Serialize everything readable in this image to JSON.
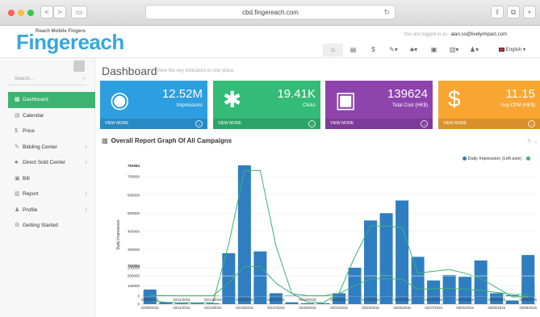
{
  "browser": {
    "url": "cbd.fingereach.com",
    "nav_back": "<",
    "nav_forward": ">",
    "dot_colors": [
      "#fc605c",
      "#fdbc40",
      "#34c84a"
    ]
  },
  "header": {
    "brand_tagline": "Reach Mobile Fingers",
    "brand_name": "Fingereach",
    "logged_in_label": "You are logged in as",
    "user_email": "alan.so@livelyimpact.com",
    "language": "English",
    "icons": [
      "home-icon",
      "calendar-icon",
      "dollar-icon",
      "bidding-icon",
      "sitemap-icon",
      "bill-icon",
      "report-icon",
      "user-icon"
    ]
  },
  "sidebar": {
    "search_placeholder": "Search...",
    "items": [
      {
        "label": "Dashboard",
        "icon": "dashboard-icon",
        "glyph": "▦",
        "active": true,
        "chevron": ""
      },
      {
        "label": "Calendar",
        "icon": "calendar-icon",
        "glyph": "▤",
        "active": false,
        "chevron": ""
      },
      {
        "label": "Price",
        "icon": "dollar-icon",
        "glyph": "$",
        "active": false,
        "chevron": ""
      },
      {
        "label": "Bidding Center",
        "icon": "gavel-icon",
        "glyph": "✎",
        "active": false,
        "chevron": "›"
      },
      {
        "label": "Direct Sold Center",
        "icon": "sitemap-icon",
        "glyph": "♣",
        "active": false,
        "chevron": "›"
      },
      {
        "label": "Bill",
        "icon": "bill-icon",
        "glyph": "▣",
        "active": false,
        "chevron": ""
      },
      {
        "label": "Report",
        "icon": "report-icon",
        "glyph": "▥",
        "active": false,
        "chevron": "›"
      },
      {
        "label": "Profile",
        "icon": "user-icon",
        "glyph": "♟",
        "active": false,
        "chevron": "›"
      },
      {
        "label": "Getting Started",
        "icon": "gears-icon",
        "glyph": "⚙",
        "active": false,
        "chevron": ""
      }
    ]
  },
  "main": {
    "title": "Dashboard",
    "subtitle": "View the key indicators in one place",
    "cards": [
      {
        "value": "12.52M",
        "label": "Impressions",
        "footer": "VIEW MORE",
        "color": "#2d9ee0",
        "icon": "eye-icon",
        "glyph": "◉"
      },
      {
        "value": "19.41K",
        "label": "Clicks",
        "footer": "VIEW MORE",
        "color": "#33bb77",
        "icon": "asterisk-icon",
        "glyph": "✱"
      },
      {
        "value": "139624",
        "label": "Total Cost (HK$)",
        "footer": "VIEW MORE",
        "color": "#8e44ad",
        "icon": "money-icon",
        "glyph": "▣"
      },
      {
        "value": "11.15",
        "label": "Avg CPM (HK$)",
        "footer": "VIEW MORE",
        "color": "#f9a532",
        "icon": "dollar-icon",
        "glyph": "$"
      }
    ],
    "chart_section_title": "Overall Report Graph Of All Campaigns",
    "legend": [
      {
        "name": "Daily Impression (Left axis)",
        "color": "#2f7ec1"
      },
      {
        "name": "",
        "color": "#3cb371"
      }
    ]
  },
  "chart_data": [
    {
      "type": "bar",
      "ylabel": "Daily Impression",
      "ylim": [
        0,
        763084
      ],
      "y_ticks": [
        0,
        100000,
        200000,
        300000,
        400000,
        500000,
        600000,
        700000
      ],
      "y_tick_labels": [
        "0",
        "100000",
        "200000",
        "300000",
        "400000",
        "500000",
        "600000",
        "700000"
      ],
      "ymax_label": "763084",
      "x_tick_labels": [
        "02/09/2015",
        "02/11/2015",
        "02/13/2015",
        "02/15/2015",
        "02/17/2015",
        "02/19/2015",
        "02/21/2015",
        "02/23/2015",
        "02/25/2015",
        "02/27/2015",
        "03/01/2015",
        "03/03/2015",
        "03/05/2015",
        "03/07/2015"
      ],
      "series": [
        {
          "name": "Daily Impression (Left axis)",
          "values": [
            80000,
            10000,
            5000,
            5000,
            5000,
            280000,
            763084,
            290000,
            60000,
            10000,
            5000,
            5000,
            60000,
            200000,
            460000,
            500000,
            570000,
            260000,
            130000,
            160000,
            150000,
            240000,
            60000,
            20000,
            270000
          ]
        },
        {
          "name": "",
          "values": [
            20000,
            10000,
            8000,
            8000,
            8000,
            330000,
            735000,
            735000,
            320000,
            60000,
            10000,
            8000,
            60000,
            260000,
            430000,
            430000,
            420000,
            170000,
            180000,
            190000,
            170000,
            140000,
            90000,
            40000,
            40000
          ]
        }
      ]
    },
    {
      "type": "bar",
      "ylim": [
        0,
        763084
      ],
      "y_tick_labels": [
        "0",
        "500000"
      ],
      "ymax_label": "763084",
      "x_tick_labels": [
        "02/09/2015",
        "02/11/2015",
        "02/13/2015",
        "02/15/2015",
        "02/17/2015",
        "02/19/2015",
        "02/21/2015",
        "02/23/2015",
        "02/25/2015",
        "02/27/2015",
        "03/01/2015",
        "03/03/2015",
        "03/05/2015",
        "03/07/2015"
      ],
      "series": [
        {
          "name": "Daily Impression (Left axis)",
          "values": [
            80000,
            10000,
            5000,
            5000,
            5000,
            280000,
            763084,
            290000,
            60000,
            10000,
            5000,
            5000,
            60000,
            200000,
            460000,
            500000,
            570000,
            260000,
            130000,
            160000,
            150000,
            240000,
            60000,
            20000,
            270000
          ]
        },
        {
          "name": "",
          "values": [
            20000,
            10000,
            8000,
            8000,
            8000,
            330000,
            735000,
            735000,
            320000,
            60000,
            10000,
            8000,
            60000,
            260000,
            430000,
            430000,
            420000,
            170000,
            180000,
            190000,
            170000,
            140000,
            90000,
            40000,
            40000
          ]
        }
      ]
    }
  ]
}
